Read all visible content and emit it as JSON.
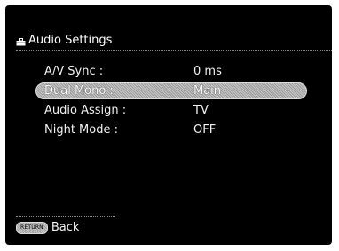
{
  "header": {
    "icon": "toolbox-icon",
    "title": "Audio Settings"
  },
  "settings": [
    {
      "label": "A/V Sync :",
      "value": "0 ms",
      "selected": false
    },
    {
      "label": "Dual Mono :",
      "value": "Main",
      "selected": true
    },
    {
      "label": "Audio Assign :",
      "value": "TV",
      "selected": false
    },
    {
      "label": "Night Mode :",
      "value": "OFF",
      "selected": false
    }
  ],
  "footer": {
    "button_label": "RETURN",
    "back_label": "Back"
  }
}
